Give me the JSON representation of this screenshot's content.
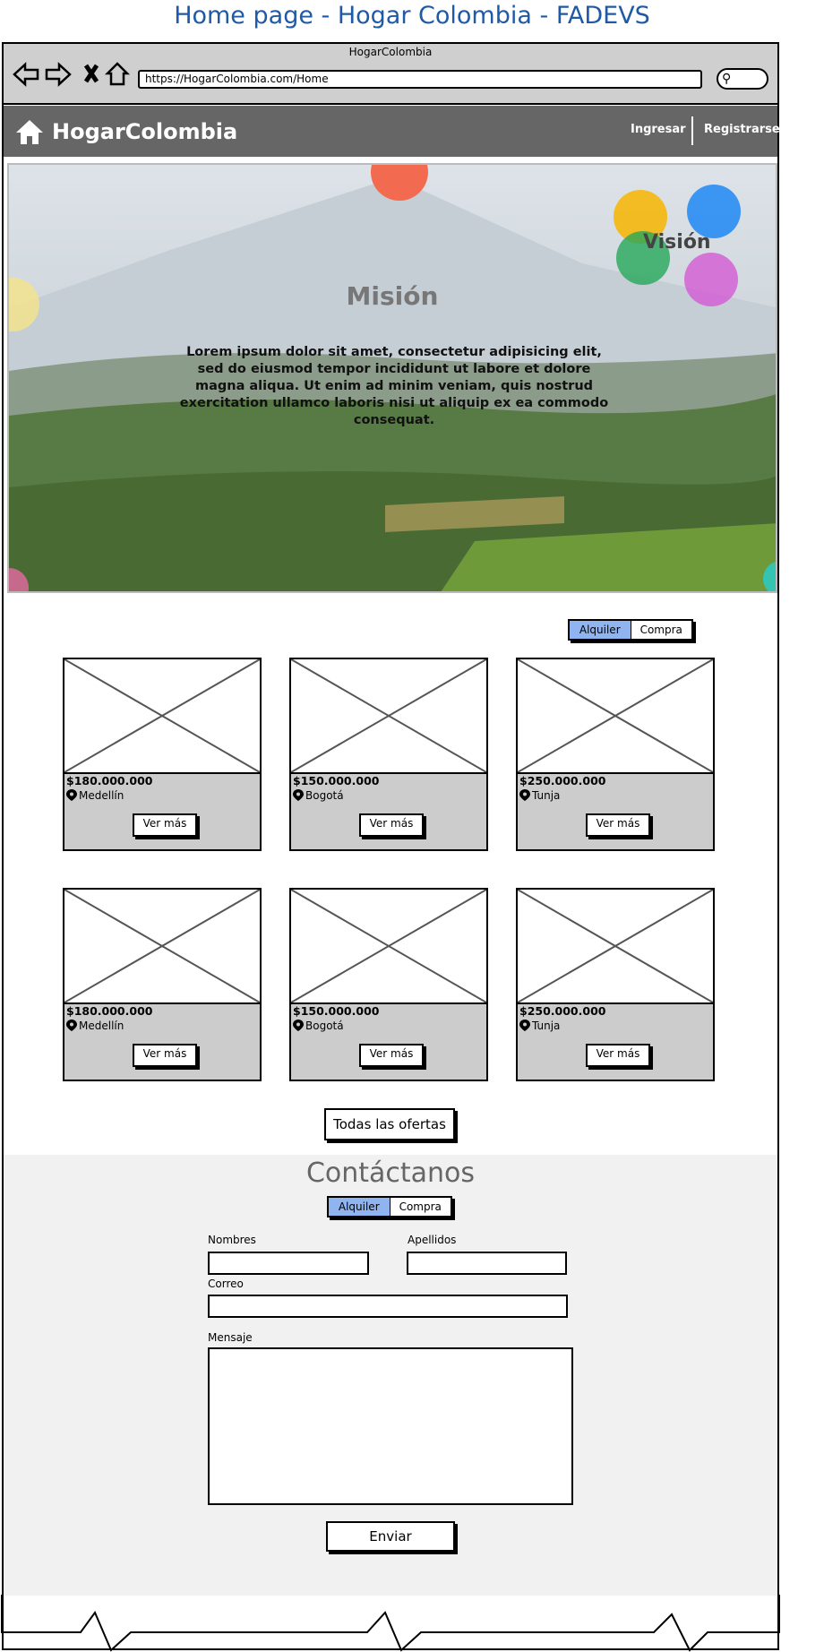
{
  "doc_title": "Home page - Hogar Colombia - FADEVS",
  "browser": {
    "window_title": "HogarColombia",
    "url": "https://HogarColombia.com/Home"
  },
  "header": {
    "brand": "HogarColombia",
    "login": "Ingresar",
    "register": "Registrarse"
  },
  "hero": {
    "mission_title": "Misión",
    "mission_text": "Lorem ipsum dolor sit amet, consectetur adipisicing elit, sed do eiusmod tempor incididunt ut labore et dolore magna aliqua. Ut enim ad minim veniam, quis nostrud exercitation ullamco laboris nisi ut aliquip ex ea commodo consequat.",
    "vision_title": "Visión"
  },
  "filters": {
    "rent": "Alquiler",
    "buy": "Compra",
    "selected": "Alquiler"
  },
  "listings": [
    {
      "price": "$180.000.000",
      "city": "Medellín",
      "button": "Ver más"
    },
    {
      "price": "$150.000.000",
      "city": "Bogotá",
      "button": "Ver más"
    },
    {
      "price": "$250.000.000",
      "city": "Tunja",
      "button": "Ver más"
    },
    {
      "price": "$180.000.000",
      "city": "Medellín",
      "button": "Ver más"
    },
    {
      "price": "$150.000.000",
      "city": "Bogotá",
      "button": "Ver más"
    },
    {
      "price": "$250.000.000",
      "city": "Tunja",
      "button": "Ver más"
    }
  ],
  "all_offers": "Todas las ofertas",
  "contact": {
    "title": "Contáctanos",
    "rent": "Alquiler",
    "buy": "Compra",
    "first_name_label": "Nombres",
    "last_name_label": "Apellidos",
    "email_label": "Correo",
    "message_label": "Mensaje",
    "send": "Enviar"
  },
  "colors": {
    "title_blue": "#1f5aa6",
    "header_gray": "#666666",
    "toggle_selected": "#8fb4f0"
  },
  "icons": [
    "back-arrow-icon",
    "forward-arrow-icon",
    "close-icon",
    "home-icon",
    "search-icon",
    "map-pin-icon",
    "image-placeholder-icon"
  ]
}
